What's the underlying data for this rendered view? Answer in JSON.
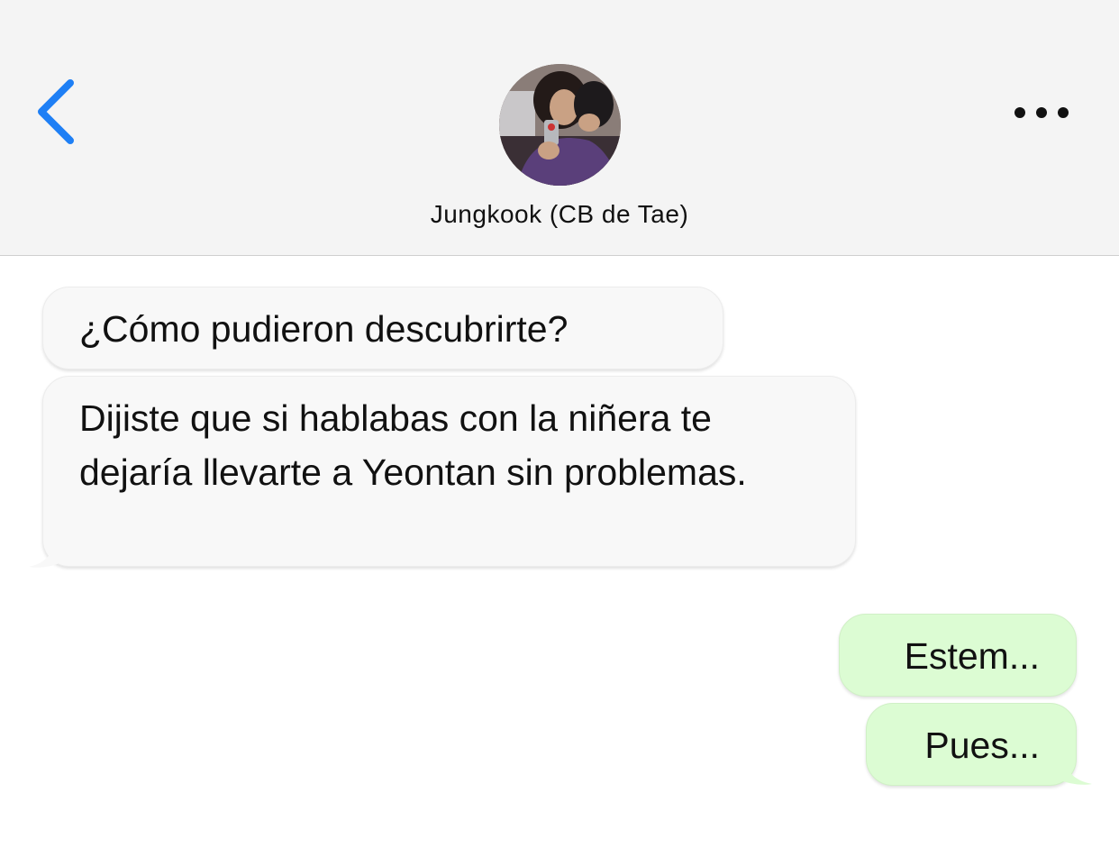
{
  "header": {
    "contact_name": "Jungkook (CB de Tae)",
    "back_icon": "chevron-left-icon",
    "more_icon": "ellipsis-icon",
    "accent_color": "#1e7ff5"
  },
  "messages": [
    {
      "direction": "incoming",
      "text": "¿Cómo pudieron descubrirte?"
    },
    {
      "direction": "incoming",
      "text": "Dijiste que si hablabas con la niñera te dejaría llevarte a Yeontan sin problemas."
    },
    {
      "direction": "outgoing",
      "text": "Estem..."
    },
    {
      "direction": "outgoing",
      "text": "Pues..."
    }
  ],
  "colors": {
    "header_bg": "#f4f4f4",
    "incoming_bubble": "#f8f8f8",
    "outgoing_bubble": "#dcfcd3"
  }
}
